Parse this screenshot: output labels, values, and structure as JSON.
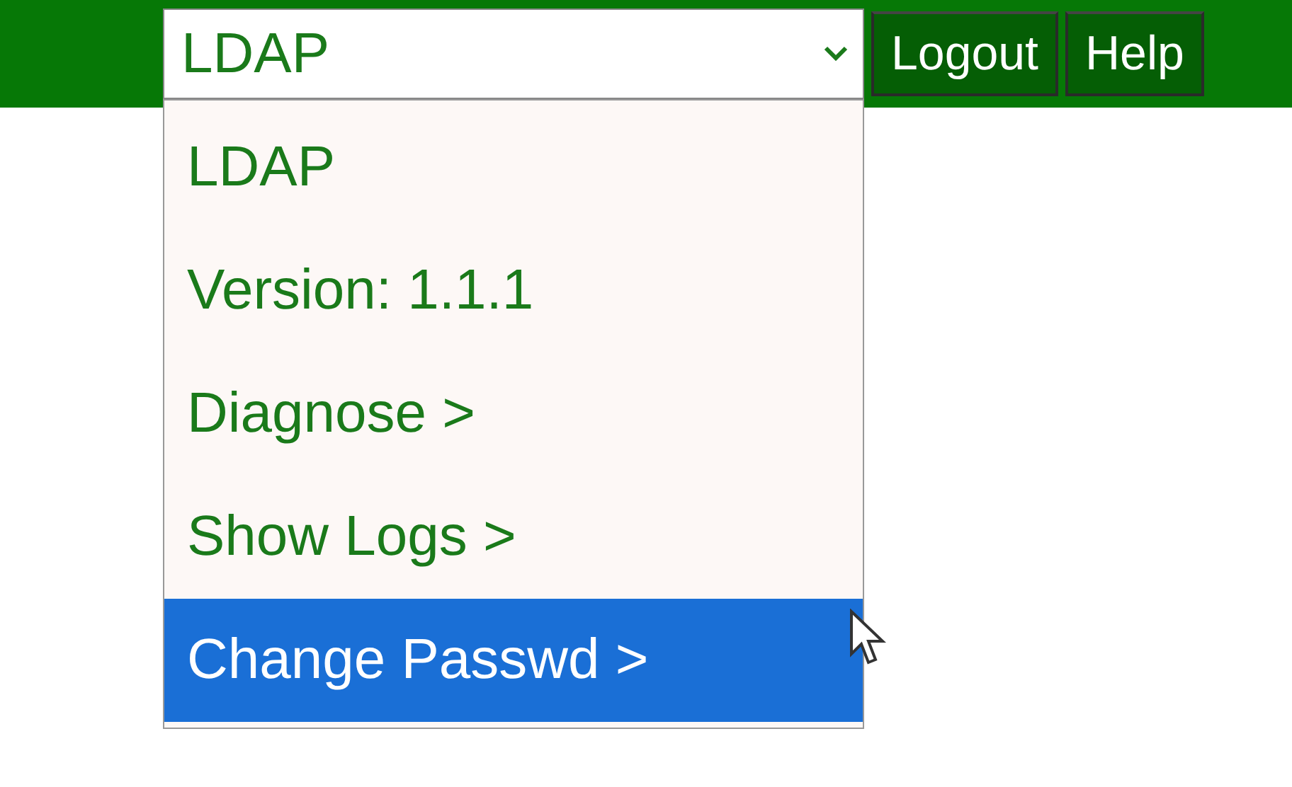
{
  "select": {
    "value": "LDAP",
    "expanded": true
  },
  "options": [
    {
      "label": "LDAP",
      "selected": false
    },
    {
      "label": "Version: 1.1.1",
      "selected": false
    },
    {
      "label": "Diagnose >",
      "selected": false
    },
    {
      "label": "Show Logs >",
      "selected": false
    },
    {
      "label": "Change Passwd >",
      "selected": true
    }
  ],
  "buttons": [
    "Logout",
    "Help"
  ]
}
